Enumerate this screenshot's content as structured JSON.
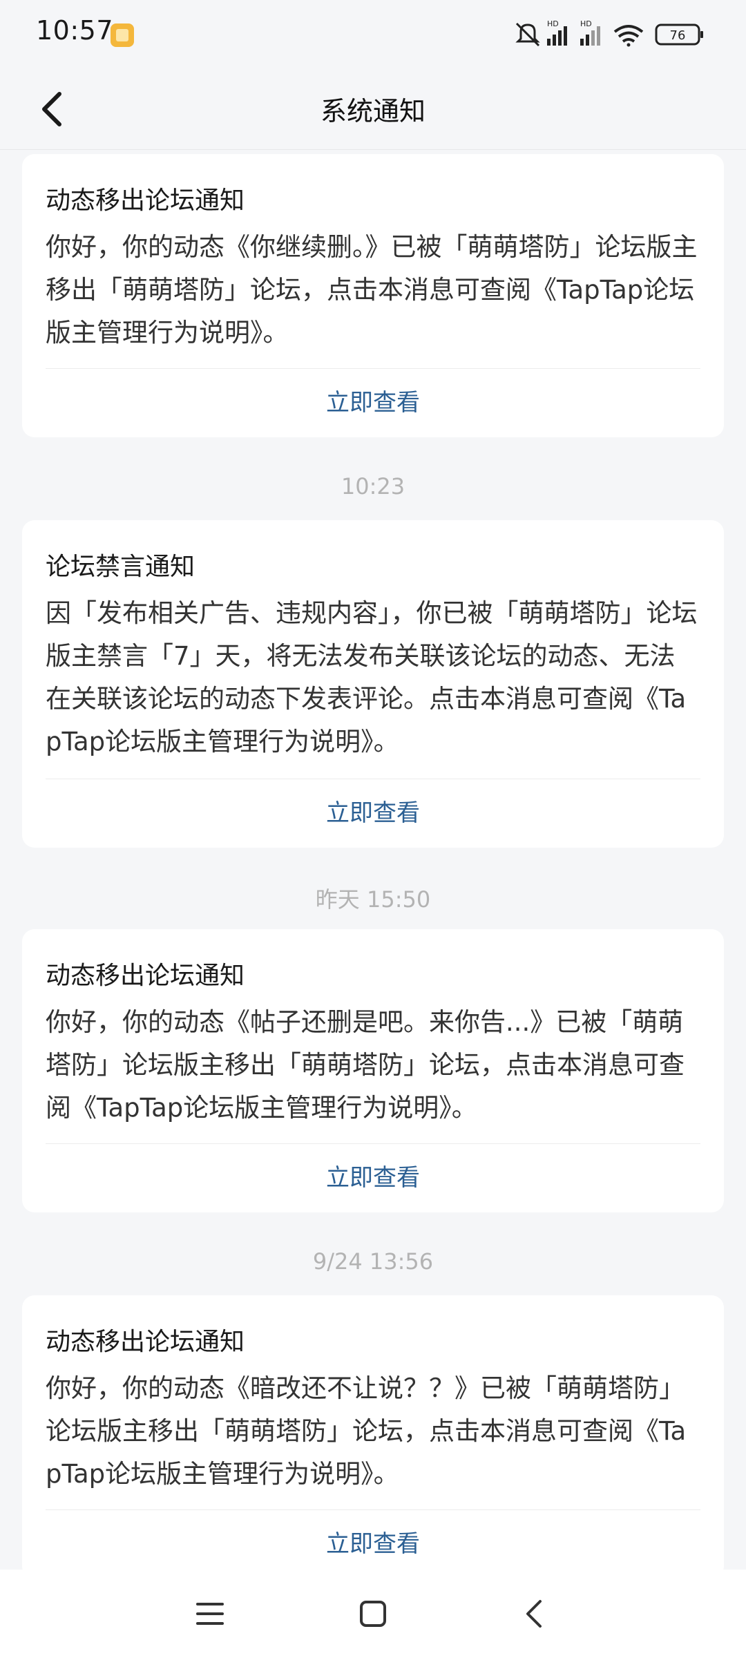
{
  "status_bar": {
    "time": "10:57",
    "battery": "76",
    "icons": [
      "app-notification-icon",
      "mute-icon",
      "signal-icon",
      "signal-icon",
      "wifi-icon",
      "battery-icon"
    ],
    "network_label_1": "HD",
    "network_label_2": "HD"
  },
  "header": {
    "title": "系统通知",
    "back_icon": "chevron-left-icon"
  },
  "items": [
    {
      "title": "动态移出论坛通知",
      "body": "你好，你的动态《你继续删。》已被「萌萌塔防」论坛版主移出「萌萌塔防」论坛，点击本消息可查阅《TapTap论坛版主管理行为说明》。",
      "action": "立即查看"
    },
    {
      "timestamp": "10:23",
      "title": "论坛禁言通知",
      "body": "因「发布相关广告、违规内容」，你已被「萌萌塔防」论坛版主禁言「7」天，将无法发布关联该论坛的动态、无法在关联该论坛的动态下发表评论。点击本消息可查阅《TapTap论坛版主管理行为说明》。",
      "action": "立即查看"
    },
    {
      "timestamp": "昨天  15:50",
      "title": "动态移出论坛通知",
      "body": "你好，你的动态《帖子还删是吧。来你告...》已被「萌萌塔防」论坛版主移出「萌萌塔防」论坛，点击本消息可查阅《TapTap论坛版主管理行为说明》。",
      "action": "立即查看"
    },
    {
      "timestamp": "9/24  13:56",
      "title": "动态移出论坛通知",
      "body": "你好，你的动态《暗改还不让说？？》已被「萌萌塔防」论坛版主移出「萌萌塔防」论坛，点击本消息可查阅《TapTap论坛版主管理行为说明》。",
      "action": "立即查看"
    }
  ],
  "nav": {
    "menu_icon": "menu-icon",
    "home_icon": "home-square-icon",
    "back_icon": "back-triangle-icon"
  },
  "colors": {
    "background": "#f5f6f8",
    "card": "#ffffff",
    "link": "#2b5f93",
    "timestamp": "#b3b3b3"
  }
}
